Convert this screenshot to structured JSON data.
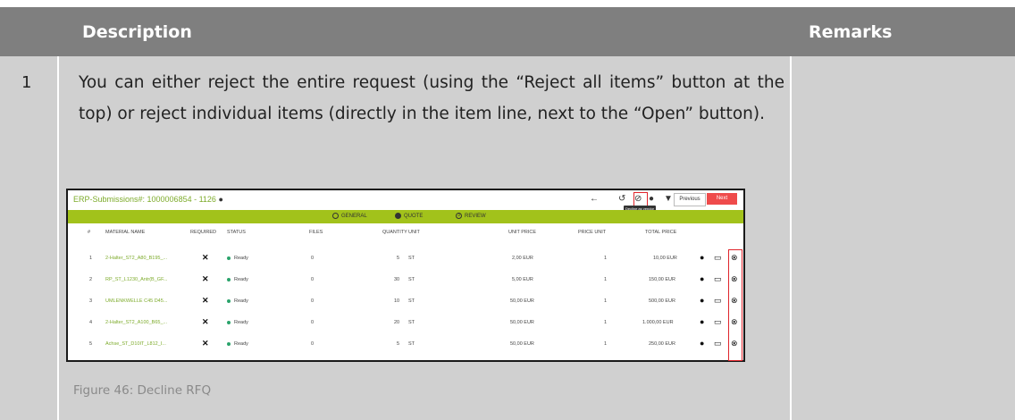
{
  "table": {
    "header": {
      "description": "Description",
      "remarks": "Remarks"
    },
    "row": {
      "number": "1",
      "text": "You can either reject the entire request (using the “Reject all items” button at the top) or reject individual items (directly in the item line, next to the “Open” button).",
      "caption": "Figure 46: Decline RFQ",
      "remarks": ""
    }
  },
  "screenshot": {
    "title": "ERP-Submissions#: 1000006854 - 1126",
    "tooltip": "Decline as vendor",
    "previous_label": "Previous",
    "next_label": "Next",
    "steps": [
      "GENERAL",
      "QUOTE",
      "REVIEW"
    ],
    "step_numbers": [
      "",
      "",
      "3"
    ],
    "columns": [
      "#",
      "MATERIAL NAME",
      "REQUIRED",
      "STATUS",
      "FILES",
      "QUANTITY",
      "UNIT",
      "UNIT PRICE",
      "PRICE UNIT",
      "TOTAL PRICE"
    ],
    "rows": [
      {
        "num": "1",
        "name": "2-Halter_ST2_A80_B195_...",
        "required": "✕",
        "status": "Ready",
        "files": "0",
        "quantity": "5",
        "unit": "ST",
        "unit_price": "2,00 EUR",
        "price_unit": "1",
        "total": "10,00 EUR"
      },
      {
        "num": "2",
        "name": "RP_ST_L1230_Antr(B_GF...",
        "required": "✕",
        "status": "Ready",
        "files": "0",
        "quantity": "30",
        "unit": "ST",
        "unit_price": "5,00 EUR",
        "price_unit": "1",
        "total": "150,00 EUR"
      },
      {
        "num": "3",
        "name": "UMLENKWELLE C45 D45...",
        "required": "✕",
        "status": "Ready",
        "files": "0",
        "quantity": "10",
        "unit": "ST",
        "unit_price": "50,00 EUR",
        "price_unit": "1",
        "total": "500,00 EUR"
      },
      {
        "num": "4",
        "name": "2-Halter_ST2_A100_B65_...",
        "required": "✕",
        "status": "Ready",
        "files": "0",
        "quantity": "20",
        "unit": "ST",
        "unit_price": "50,00 EUR",
        "price_unit": "1",
        "total": "1.000,00 EUR"
      },
      {
        "num": "5",
        "name": "Achse_ST_D10IT_L812_I...",
        "required": "✕",
        "status": "Ready",
        "files": "0",
        "quantity": "5",
        "unit": "ST",
        "unit_price": "50,00 EUR",
        "price_unit": "1",
        "total": "250,00 EUR"
      }
    ],
    "colors": {
      "accent_green": "#a2c21b",
      "link_green": "#7dab2b",
      "next_red": "#ef4b4b",
      "highlight_red": "#e0242b"
    }
  }
}
